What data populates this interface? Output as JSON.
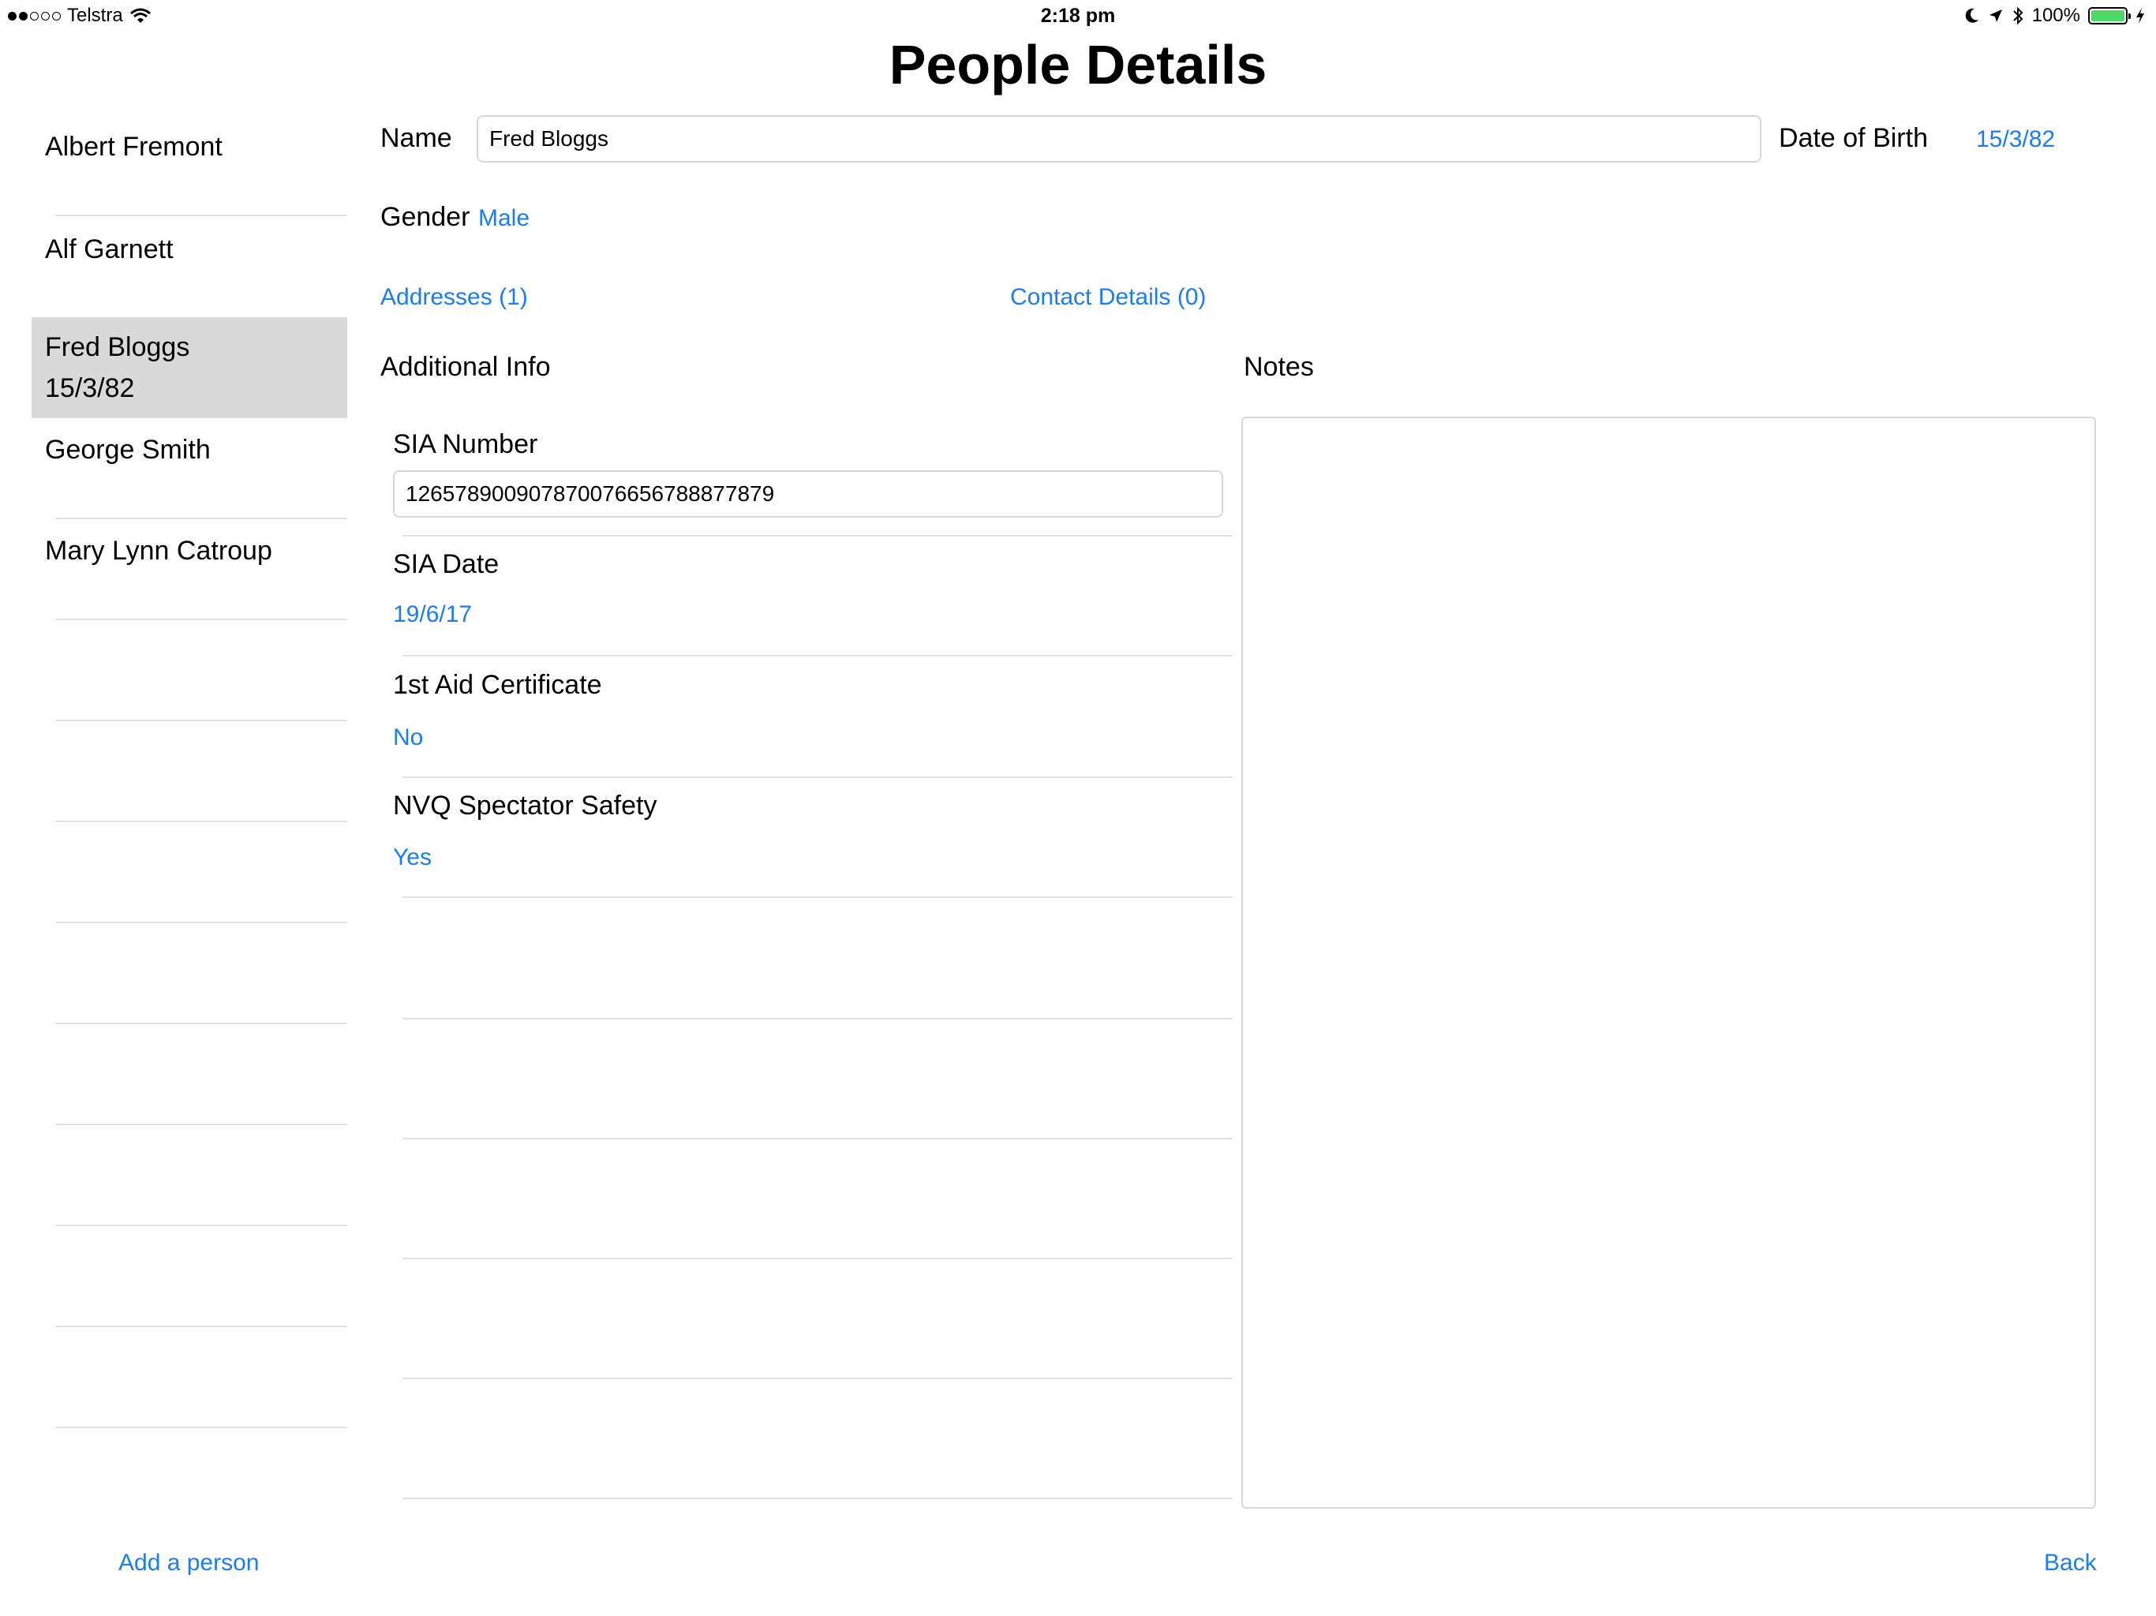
{
  "status_bar": {
    "carrier": "Telstra",
    "time": "2:18 pm",
    "battery": "100%",
    "battery_color": "#4cd964"
  },
  "page_title": "People Details",
  "people": [
    {
      "name": "Albert Fremont",
      "dob": ""
    },
    {
      "name": "Alf Garnett",
      "dob": ""
    },
    {
      "name": "Fred Bloggs",
      "dob": "15/3/82",
      "selected": true
    },
    {
      "name": "George Smith",
      "dob": ""
    },
    {
      "name": "Mary Lynn Catroup",
      "dob": ""
    }
  ],
  "form": {
    "name_label": "Name",
    "name_value": "Fred Bloggs",
    "dob_label": "Date of Birth",
    "dob_value": "15/3/82",
    "gender_label": "Gender",
    "gender_value": "Male",
    "addresses_link": "Addresses (1)",
    "contact_link": "Contact Details (0)",
    "additional_info_label": "Additional Info",
    "notes_label": "Notes"
  },
  "additional_info": {
    "sia_number_label": "SIA Number",
    "sia_number_value": "126578900907870076656788877879",
    "sia_date_label": "SIA Date",
    "sia_date_value": "19/6/17",
    "first_aid_label": "1st Aid Certificate",
    "first_aid_value": "No",
    "nvq_label": "NVQ Spectator Safety",
    "nvq_value": "Yes"
  },
  "footer": {
    "add_person": "Add a person",
    "back": "Back"
  },
  "colors": {
    "accent": "#1a7ef0",
    "selection": "#d9d9d9"
  }
}
